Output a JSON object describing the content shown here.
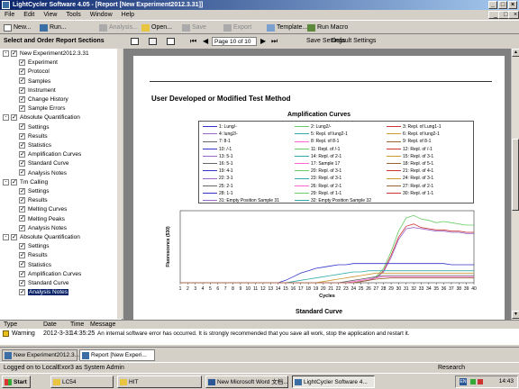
{
  "window": {
    "title": "LightCycler Software 4.05 - [Report [New Experiment2012.3.31]]"
  },
  "menu": [
    "File",
    "Edit",
    "View",
    "Tools",
    "Window",
    "Help"
  ],
  "toolbar": {
    "new": "New...",
    "run": "Run...",
    "analysis": "Analysis...",
    "open": "Open...",
    "save": "Save",
    "export": "Export",
    "template": "Template...",
    "run_macro": "Run Macro"
  },
  "left": {
    "header": "Select and Order Report Sections"
  },
  "tree": [
    {
      "label": "New Experiment2012.3.31",
      "level": 0
    },
    {
      "label": "Experiment",
      "level": 1
    },
    {
      "label": "Protocol",
      "level": 1
    },
    {
      "label": "Samples",
      "level": 1
    },
    {
      "label": "Instrument",
      "level": 1
    },
    {
      "label": "Change History",
      "level": 1
    },
    {
      "label": "Sample Errors",
      "level": 1
    },
    {
      "label": "Absolute Quantification",
      "level": 0
    },
    {
      "label": "Settings",
      "level": 1
    },
    {
      "label": "Results",
      "level": 1
    },
    {
      "label": "Statistics",
      "level": 1
    },
    {
      "label": "Amplification Curves",
      "level": 1
    },
    {
      "label": "Standard Curve",
      "level": 1
    },
    {
      "label": "Analysis Notes",
      "level": 1
    },
    {
      "label": "Tm Calling",
      "level": 0
    },
    {
      "label": "Settings",
      "level": 1
    },
    {
      "label": "Results",
      "level": 1
    },
    {
      "label": "Melting Curves",
      "level": 1
    },
    {
      "label": "Melting Peaks",
      "level": 1
    },
    {
      "label": "Analysis Notes",
      "level": 1
    },
    {
      "label": "Absolute Quantification",
      "level": 0
    },
    {
      "label": "Settings",
      "level": 1
    },
    {
      "label": "Results",
      "level": 1
    },
    {
      "label": "Statistics",
      "level": 1
    },
    {
      "label": "Amplification Curves",
      "level": 1
    },
    {
      "label": "Standard Curve",
      "level": 1
    },
    {
      "label": "Analysis Notes",
      "level": 1,
      "selected": true
    }
  ],
  "report_toolbar": {
    "page": "Page 10 of 10",
    "save_settings": "Save Settings",
    "default_settings": "Default Settings"
  },
  "report": {
    "section_title": "User Developed or Modified Test Method",
    "chart_title": "Amplification Curves",
    "next_title": "Standard Curve"
  },
  "legend": [
    [
      "1: Lung/-",
      "2: Lung2/-",
      "3: Repl. of Lung1-1"
    ],
    [
      "4: lung2/-",
      "5: Repl. of lung2-1",
      "6: Repl. of lung2-1"
    ],
    [
      "7: 8-1",
      "8: Repl. of 8-1",
      "9: Repl. of 8-1"
    ],
    [
      "10: /-1",
      "11: Repl. of /-1",
      "12: Repl. of /-1"
    ],
    [
      "13: 5-1",
      "14: Repl. of 2-1",
      "15: Repl. of 3-1"
    ],
    [
      "16: 5-1",
      "17: Sample 17",
      "18: Repl. of 5-1"
    ],
    [
      "19: 4-1",
      "20: Repl. of 3-1",
      "21: Repl. of 4-1"
    ],
    [
      "22: 3-1",
      "23: Repl. of 3-1",
      "24: Repl. of 3-1"
    ],
    [
      "25: 2-1",
      "26: Repl. of 2-1",
      "27: Repl. of 2-1"
    ],
    [
      "28: 1-1",
      "29: Repl. of 1-1",
      "30: Repl. of 1-1"
    ],
    [
      "31: Empty Position Sample 31",
      "32: Empty Position Sample 32",
      ""
    ]
  ],
  "legend_colors": [
    "#3333cc",
    "#66cc66",
    "#cc3333",
    "#9966cc",
    "#33aaaa",
    "#cc9933",
    "#666666",
    "#ff66cc",
    "#996633"
  ],
  "chart_data": {
    "type": "line",
    "xlabel": "Cycles",
    "ylabel": "Fluorescence (530)",
    "x": [
      1,
      2,
      3,
      4,
      5,
      6,
      7,
      8,
      9,
      10,
      11,
      12,
      13,
      14,
      15,
      16,
      17,
      18,
      19,
      20,
      21,
      22,
      23,
      24,
      25,
      26,
      27,
      28,
      29,
      30,
      31,
      32,
      33,
      34,
      35,
      36,
      37,
      38,
      39,
      40
    ],
    "series": [
      {
        "color": "#66cc66",
        "values": [
          0,
          0,
          0,
          0,
          0,
          0,
          0,
          0,
          0,
          0,
          0,
          0,
          0,
          0,
          0,
          0,
          0,
          0,
          0,
          0,
          0,
          0,
          0,
          0,
          0.1,
          0.2,
          0.5,
          1.2,
          2.6,
          4.3,
          5.4,
          5.6,
          5.3,
          5.2,
          5.0,
          5.1,
          5.0,
          4.9,
          4.8,
          4.8
        ]
      },
      {
        "color": "#cc3333",
        "values": [
          0,
          0,
          0,
          0,
          0,
          0,
          0,
          0,
          0,
          0,
          0,
          0,
          0,
          0,
          0,
          0,
          0,
          0,
          0,
          0,
          0,
          0,
          0,
          0,
          0.1,
          0.2,
          0.4,
          1.0,
          2.3,
          3.8,
          4.7,
          4.9,
          4.6,
          4.5,
          4.4,
          4.4,
          4.3,
          4.3,
          4.2,
          4.2
        ]
      },
      {
        "color": "#9966cc",
        "values": [
          0,
          0,
          0,
          0,
          0,
          0,
          0,
          0,
          0,
          0,
          0,
          0,
          0,
          0,
          0,
          0,
          0,
          0,
          0,
          0,
          0,
          0,
          0,
          0,
          0.1,
          0.2,
          0.4,
          0.9,
          2.1,
          3.6,
          4.5,
          4.6,
          4.5,
          4.4,
          4.3,
          4.3,
          4.2,
          4.2,
          4.1,
          4.1
        ]
      },
      {
        "color": "#3333cc",
        "values": [
          0,
          0,
          0,
          0,
          0,
          0,
          0,
          0,
          0,
          0,
          0,
          0,
          0,
          0,
          0.2,
          0.5,
          0.8,
          1.0,
          1.2,
          1.3,
          1.4,
          1.5,
          1.5,
          1.6,
          1.6,
          1.6,
          1.6,
          1.6,
          1.6,
          1.6,
          1.6,
          1.6,
          1.6,
          1.6,
          1.6,
          1.6,
          1.5,
          1.5,
          1.5,
          1.5
        ]
      },
      {
        "color": "#33aaaa",
        "values": [
          0,
          0,
          0,
          0,
          0,
          0,
          0,
          0,
          0,
          0,
          0,
          0,
          0,
          0,
          0,
          0.1,
          0.2,
          0.3,
          0.4,
          0.5,
          0.6,
          0.7,
          0.8,
          0.9,
          0.9,
          1.0,
          1.0,
          1.0,
          1.0,
          1.0,
          1.0,
          1.0,
          1.0,
          1.0,
          1.0,
          1.0,
          1.0,
          1.0,
          1.0,
          1.0
        ]
      },
      {
        "color": "#cc9933",
        "values": [
          0,
          0,
          0,
          0,
          0,
          0,
          0,
          0,
          0,
          0,
          0,
          0,
          0,
          0,
          0,
          0,
          0,
          0,
          0,
          0.1,
          0.2,
          0.3,
          0.4,
          0.5,
          0.6,
          0.7,
          0.8,
          0.8,
          0.8,
          0.8,
          0.8,
          0.8,
          0.8,
          0.8,
          0.8,
          0.8,
          0.8,
          0.8,
          0.8,
          0.8
        ]
      },
      {
        "color": "#666666",
        "values": [
          0,
          0,
          0,
          0,
          0,
          0,
          0,
          0,
          0,
          0,
          0,
          0,
          0,
          0,
          0,
          0,
          0,
          0,
          0,
          0,
          0,
          0,
          0.1,
          0.2,
          0.3,
          0.4,
          0.5,
          0.6,
          0.6,
          0.6,
          0.6,
          0.6,
          0.6,
          0.6,
          0.6,
          0.6,
          0.6,
          0.6,
          0.6,
          0.6
        ]
      },
      {
        "color": "#ff66cc",
        "values": [
          0,
          0,
          0,
          0,
          0,
          0,
          0,
          0,
          0,
          0,
          0,
          0,
          0,
          0,
          0,
          0,
          0,
          0,
          0,
          0,
          0,
          0,
          0,
          0.1,
          0.2,
          0.3,
          0.4,
          0.5,
          0.5,
          0.5,
          0.5,
          0.5,
          0.5,
          0.5,
          0.5,
          0.5,
          0.5,
          0.5,
          0.5,
          0.5
        ]
      },
      {
        "color": "#996633",
        "values": [
          0,
          0,
          0,
          0,
          0,
          0,
          0,
          0,
          0,
          0,
          0,
          0,
          0,
          0,
          0,
          0,
          0,
          0,
          0,
          0,
          0,
          0,
          0,
          0,
          0.1,
          0.2,
          0.3,
          0.35,
          0.4,
          0.4,
          0.4,
          0.4,
          0.4,
          0.4,
          0.4,
          0.4,
          0.4,
          0.4,
          0.4,
          0.4
        ]
      }
    ],
    "ylim": [
      0,
      6
    ]
  },
  "messages": {
    "headers": [
      "Type",
      "Date",
      "Time",
      "Message"
    ],
    "row": {
      "type": "Warning",
      "date": "2012-3-31",
      "time": "14:35:25",
      "message": "An internal software error has occurred. It is strongly recommended that you save all work, stop the application and restart it."
    }
  },
  "doctabs": [
    "New Experiment2012.3....",
    "Report [New Experi..."
  ],
  "status": {
    "left": "Logged on to LocalExor3 as System Admin",
    "right": "Research"
  },
  "taskbar": {
    "start": "Start",
    "tasks": [
      "LC54",
      "HIT",
      "New Microsoft Word 文档...",
      "LightCycler Software 4..."
    ],
    "lang": "EN",
    "clock": "14:43"
  }
}
